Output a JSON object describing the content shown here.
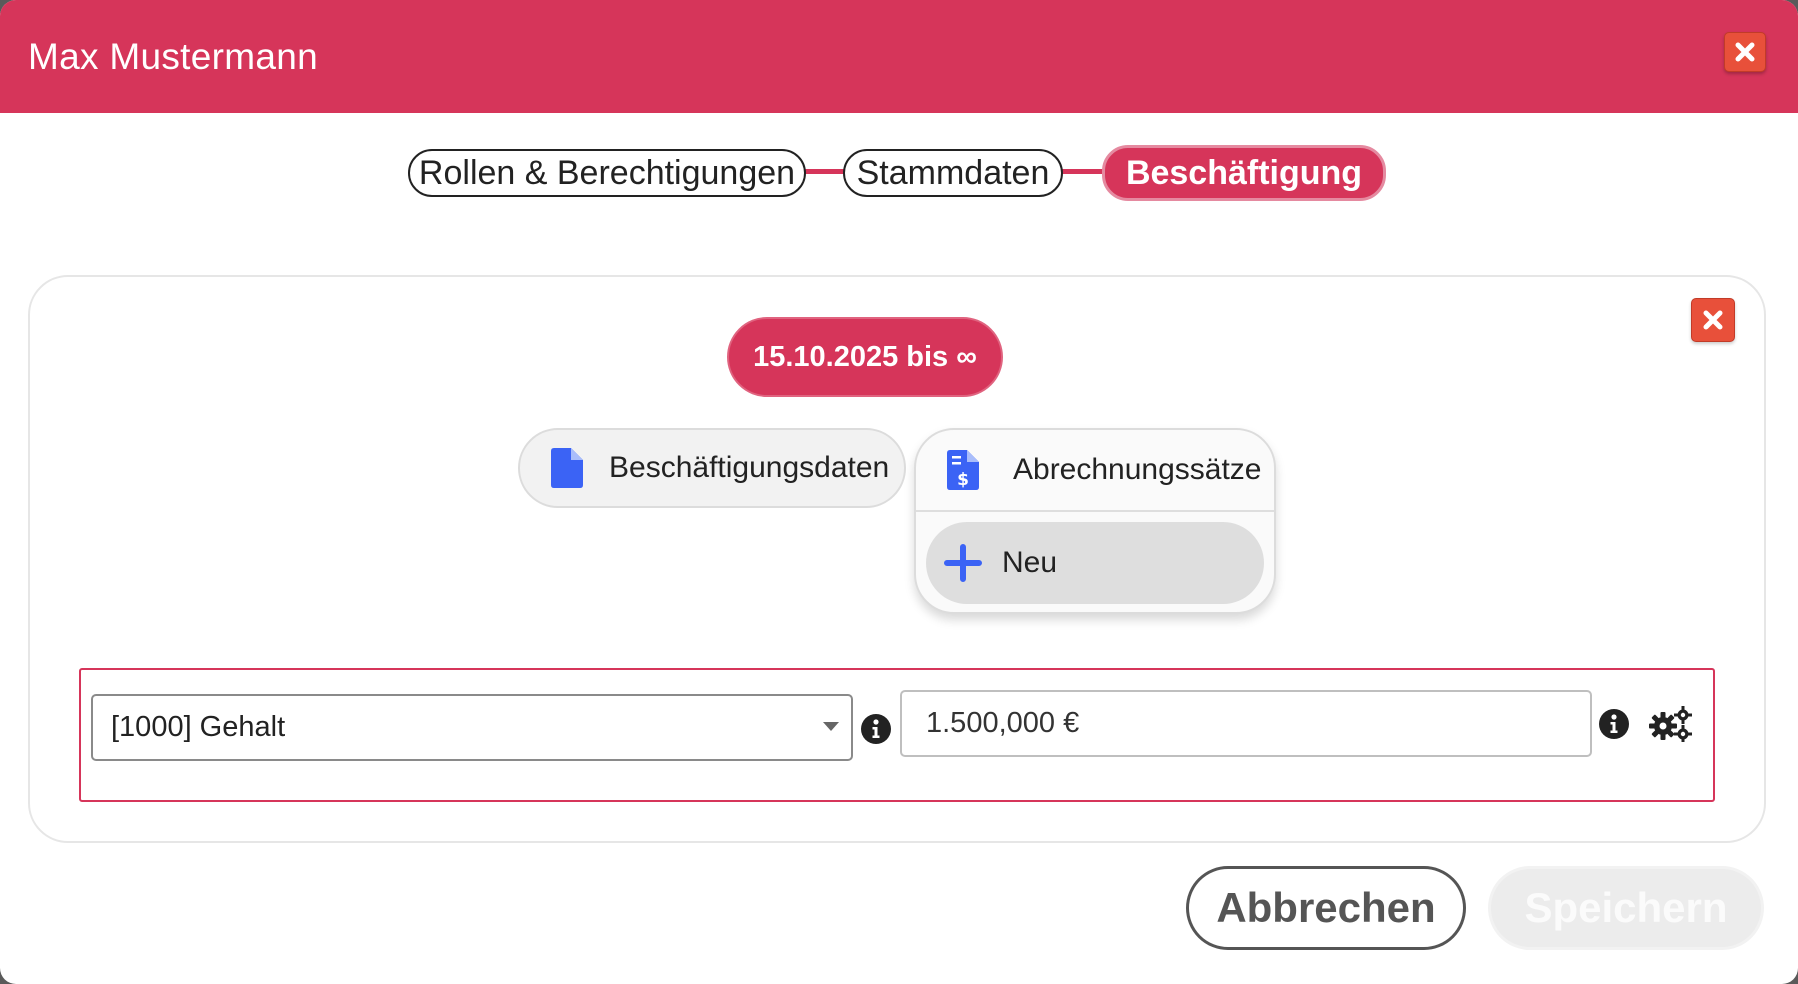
{
  "dialog": {
    "title": "Max Mustermann"
  },
  "stepper": {
    "steps": [
      {
        "label": "Rollen & Berechtigungen"
      },
      {
        "label": "Stammdaten"
      },
      {
        "label": "Beschäftigung"
      }
    ],
    "active": "Beschäftigung"
  },
  "period": {
    "label": "15.10.2025 bis ∞"
  },
  "tabs": {
    "employment_data": "Beschäftigungsdaten",
    "billing_rates": "Abrechnungssätze",
    "billing_menu": {
      "items": [
        {
          "label": "Neu",
          "icon": "plus-icon"
        }
      ]
    }
  },
  "rate_row": {
    "type_select": {
      "value": "[1000] Gehalt"
    },
    "amount_input": {
      "value": "1.500,000 €"
    }
  },
  "footer": {
    "cancel_label": "Abbrechen",
    "save_label": "Speichern",
    "save_enabled": false
  },
  "colors": {
    "accent": "#d6355a",
    "close": "#e8503a",
    "icon_blue": "#3b63f5"
  }
}
